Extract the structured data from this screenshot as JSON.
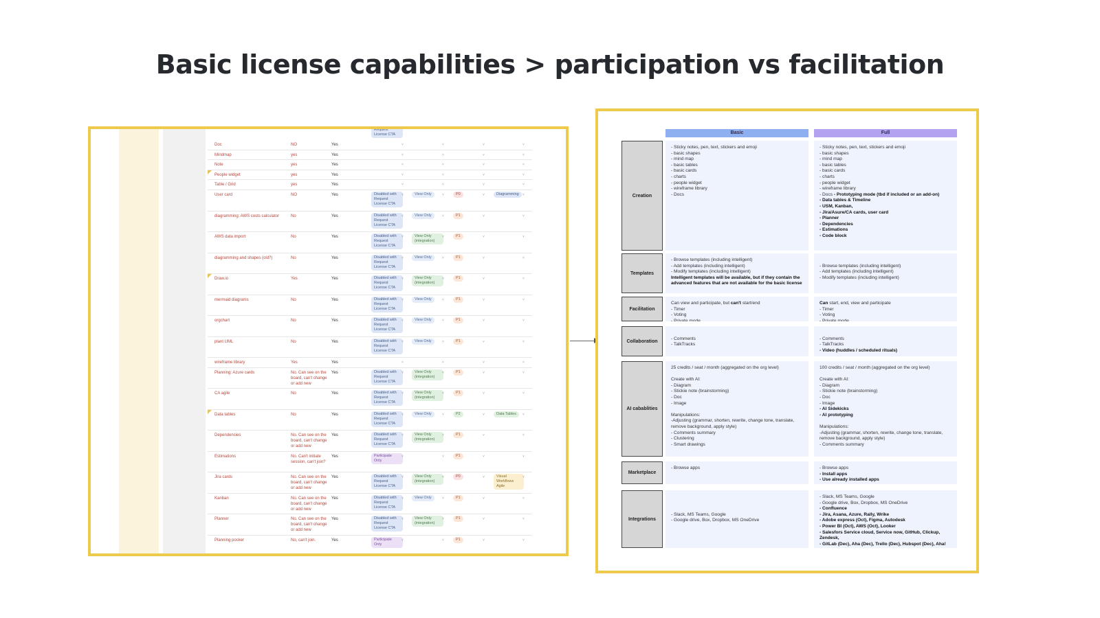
{
  "title": "Basic license capabilities > participation vs facilitation",
  "left_table": {
    "top_partial": [
      "Request",
      "License CTA"
    ],
    "rows": [
      {
        "feature": "Doc",
        "c2": "NO",
        "c3": "Yes",
        "status": "",
        "view": "",
        "pri": "",
        "tag": ""
      },
      {
        "feature": "Mindmap",
        "c2": "yes",
        "c3": "Yes",
        "status": "",
        "view": "",
        "pri": "",
        "tag": ""
      },
      {
        "feature": "Note",
        "c2": "yes",
        "c3": "Yes",
        "status": "",
        "view": "",
        "pri": "",
        "tag": ""
      },
      {
        "feature": "People widget",
        "c2": "yes",
        "c3": "Yes",
        "status": "",
        "view": "",
        "pri": "",
        "tag": ""
      },
      {
        "feature": "Table / Grid",
        "c2": "yes",
        "c3": "Yes",
        "status": "",
        "view": "",
        "pri": "",
        "tag": ""
      },
      {
        "feature": "User card",
        "c2": "NO",
        "c3": "Yes",
        "status": "Disabled with Request License CTA",
        "view": "View Only",
        "pri": "P0",
        "tag": "Diagramming"
      },
      {
        "feature": "diagramming: AWS costs calculator",
        "c2": "No",
        "c3": "Yes",
        "status": "Disabled with Request License CTA",
        "view": "View Only",
        "pri": "P1",
        "tag": ""
      },
      {
        "feature": "AWS data import",
        "c2": "No",
        "c3": "Yes",
        "status": "Disabled with Request License CTA",
        "view": "View Only (integration)",
        "pri": "P1",
        "tag": ""
      },
      {
        "feature": "diagramming and shapes (old?)",
        "c2": "No",
        "c3": "Yes",
        "status": "Disabled with Request License CTA",
        "view": "View Only",
        "pri": "P1",
        "tag": ""
      },
      {
        "feature": "Draw.io",
        "c2": "Yes",
        "c3": "Yes",
        "status": "Disabled with Request License CTA",
        "view": "View Only (integration)",
        "pri": "P1",
        "tag": ""
      },
      {
        "feature": "mermaid diagrams",
        "c2": "No",
        "c3": "Yes",
        "status": "Disabled with Request License CTA",
        "view": "View Only",
        "pri": "P1",
        "tag": ""
      },
      {
        "feature": "orgchart",
        "c2": "No",
        "c3": "Yes",
        "status": "Disabled with Request License CTA",
        "view": "View Only",
        "pri": "P1",
        "tag": ""
      },
      {
        "feature": "plant UML",
        "c2": "No",
        "c3": "Yes",
        "status": "Disabled with Request License CTA",
        "view": "View Only",
        "pri": "P1",
        "tag": ""
      },
      {
        "feature": "wireframe library",
        "c2": "Yes",
        "c3": "Yes",
        "status": "",
        "view": "",
        "pri": "",
        "tag": ""
      },
      {
        "feature": "Planning: Azure cards",
        "c2": "No. Can see on the board, can't change or add new",
        "c3": "Yes",
        "status": "Disabled with Request License CTA",
        "view": "View Only (integration)",
        "pri": "P1",
        "tag": ""
      },
      {
        "feature": "CA agile",
        "c2": "No",
        "c3": "Yes",
        "status": "Disabled with Request License CTA",
        "view": "View Only (integration)",
        "pri": "P1",
        "tag": ""
      },
      {
        "feature": "Data tables",
        "c2": "No",
        "c3": "Yes",
        "status": "Disabled with Request License CTA",
        "view": "View Only",
        "pri": "P2",
        "tag": "Data Tables"
      },
      {
        "feature": "Dependencies",
        "c2": "No. Can see on the board, can't change or add new",
        "c3": "Yes",
        "status": "Disabled with Request License CTA",
        "view": "View Only (integration)",
        "pri": "P1",
        "tag": ""
      },
      {
        "feature": "Estimations",
        "c2": "No. Can't initiate session, can't join?",
        "c3": "Yes",
        "status": "Participate Only",
        "view": "",
        "pri": "P1",
        "tag": ""
      },
      {
        "feature": "Jira cards",
        "c2": "No. Can see on the board, can't change or add new",
        "c3": "Yes",
        "status": "Disabled with Request License CTA",
        "view": "View Only (integration)",
        "pri": "P0",
        "tag": "Visual Workflows Agile"
      },
      {
        "feature": "Kanban",
        "c2": "No. Can see on the board, can't change or add new",
        "c3": "Yes",
        "status": "Disabled with Request License CTA",
        "view": "View Only",
        "pri": "P1",
        "tag": ""
      },
      {
        "feature": "Planner",
        "c2": "No. Can see on the board, can't change or add new",
        "c3": "Yes",
        "status": "Disabled with Request License CTA",
        "view": "View Only (integration)",
        "pri": "P1",
        "tag": ""
      },
      {
        "feature": "Planning pocker",
        "c2": "No, can't join.",
        "c3": "Yes",
        "status": "Participate Only",
        "view": "",
        "pri": "P1",
        "tag": ""
      }
    ]
  },
  "comparison": {
    "basic_header": "Basic",
    "full_header": "Full",
    "rows": [
      {
        "category": "Creation",
        "basic": [
          {
            "t": " - Sticky notes, pen, text, stickers and emoji\n - basic shapes\n - mind map\n - basic tables\n - basic cards\n - charts\n - people widget\n - wireframe library\n - Docs",
            "b": false
          }
        ],
        "full": [
          {
            "t": " - Sticky notes, pen, text, stickers and emoji\n - basic shapes\n - mind map\n - basic tables\n - basic cards\n - charts\n - people widget\n - wireframe library\n - Docs",
            "b": false
          },
          {
            "t": " - Prototyping mode (tbd if included or an add-on)\n - Data tables & Timeline\n - USM, Kanban,\n - Jira/Asure/CA cards, user card\n - Planner\n - Dependencies\n - Estimations\n - Code block",
            "b": true
          }
        ]
      },
      {
        "category": "Templates",
        "basic": [
          {
            "t": "- Browse templates (including intelligent)\n- Add templates (including intelligent)\n- Modify templates (including intelligent)\n ",
            "b": false
          },
          {
            "t": "Intelligent templates will be available, but if they contain the advanced features that are not available for the basic license",
            "b": true
          }
        ],
        "full": [
          {
            "t": "\n- Browse templates (including intelligent)\n- Add templates (including intelligent)\n- Modify templates (including intelligent)",
            "b": false
          }
        ]
      },
      {
        "category": "Facilitation",
        "basic": [
          {
            "t": "Can view and participate, but ",
            "b": false
          },
          {
            "t": "can't",
            "b": true
          },
          {
            "t": " start/end\n- Timer\n- Voting\n- Private mode",
            "b": false
          }
        ],
        "full": [
          {
            "t": "Can",
            "b": true
          },
          {
            "t": " start, end, view and participate\n- Timer\n- Voting\n- Private mode",
            "b": false
          }
        ]
      },
      {
        "category": "Collaboration",
        "basic": [
          {
            "t": "\n - Comments\n - TalkTracks",
            "b": false
          }
        ],
        "full": [
          {
            "t": "\n- Comments\n- TalkTracks\n",
            "b": false
          },
          {
            "t": "- Video (huddles / scheduled rituals)",
            "b": true
          }
        ]
      },
      {
        "category": "AI cabablities",
        "basic": [
          {
            "t": "25 credits / seat / month (aggregated on the org level)\n\n Create with AI:\n - Diagram\n - Stickie note (brainstorming)\n - Doc\n - Image\n\n Manipulations:\n -Adjusting  (grammar, shorten, rewrite, change tone, translate, remove background, apply style)\n - Comments summary\n - Clustering\n - Smart drawings",
            "b": false
          }
        ],
        "full": [
          {
            "t": "100 credits / seat / month (aggregated on the org level)\n\n Create with AI:\n - Diagram\n - Stickie note (brainstorming)\n - Doc\n - Image\n",
            "b": false
          },
          {
            "t": " - AI Sidekicks\n - AI prototyping\n",
            "b": true
          },
          {
            "t": "\n Manipulations:\n -Adjusting  (grammar, shorten, rewrite, change tone, translate, remove background, apply style)\n - Comments summary",
            "b": false
          }
        ]
      },
      {
        "category": "Marketplace",
        "basic": [
          {
            "t": "- Browse apps",
            "b": false
          }
        ],
        "full": [
          {
            "t": "- Browse apps\n",
            "b": false
          },
          {
            "t": "- Install apps\n- Use already installed apps",
            "b": true
          }
        ]
      },
      {
        "category": "Integrations",
        "basic": [
          {
            "t": "\n\n\n - Slack, MS Teams, Google\n - Google drive, Box, Dropbox, MS OneDrive",
            "b": false
          }
        ],
        "full": [
          {
            "t": "- Slack, MS Teams, Google\n- Google drive, Box, Dropbox, MS OneDrive\n",
            "b": false
          },
          {
            "t": "- Confluence\n- Jira, Asana, Azure, Rally, Wrike\n- Adobe express (Oct), Figma, Autodesk\n- Power BI (Oct), AWS (Oct), Looker\n- Salesfors Service cloud, Service now, GitHub, Clickup, Zendesk,\n- GitLab (Dec), Aha (Dec), Trello (Dec), Hubspot (Dec), Aha!",
            "b": true
          }
        ]
      }
    ]
  }
}
